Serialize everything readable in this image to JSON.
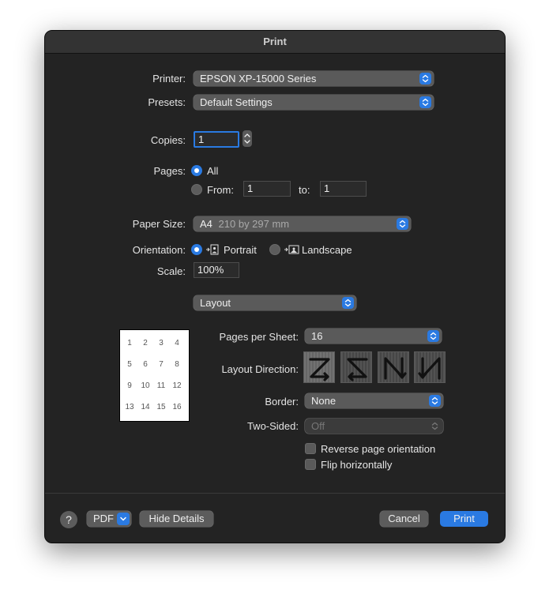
{
  "window": {
    "title": "Print"
  },
  "printer": {
    "label": "Printer:",
    "value": "EPSON XP-15000 Series"
  },
  "presets": {
    "label": "Presets:",
    "value": "Default Settings"
  },
  "copies": {
    "label": "Copies:",
    "value": "1"
  },
  "pages": {
    "label": "Pages:",
    "all_label": "All",
    "from_label": "From:",
    "from_value": "1",
    "to_label": "to:",
    "to_value": "1",
    "selected": "All"
  },
  "paper_size": {
    "label": "Paper Size:",
    "name": "A4",
    "dims": "210 by 297 mm"
  },
  "orientation": {
    "label": "Orientation:",
    "portrait_label": "Portrait",
    "landscape_label": "Landscape",
    "selected": "Portrait"
  },
  "scale": {
    "label": "Scale:",
    "value": "100%"
  },
  "section": {
    "value": "Layout"
  },
  "layout": {
    "pages_per_sheet_label": "Pages per Sheet:",
    "pages_per_sheet_value": "16",
    "direction_label": "Layout Direction:",
    "directions": [
      "z-right-down-icon",
      "z-left-down-icon",
      "n-down-right-icon",
      "n-down-left-icon"
    ],
    "border_label": "Border:",
    "border_value": "None",
    "two_sided_label": "Two-Sided:",
    "two_sided_value": "Off",
    "reverse_label": "Reverse page orientation",
    "flip_label": "Flip horizontally"
  },
  "preview": {
    "pages": [
      "1",
      "2",
      "3",
      "4",
      "5",
      "6",
      "7",
      "8",
      "9",
      "10",
      "11",
      "12",
      "13",
      "14",
      "15",
      "16"
    ]
  },
  "footer": {
    "help": "?",
    "pdf_label": "PDF",
    "hide_details": "Hide Details",
    "cancel": "Cancel",
    "print": "Print"
  },
  "colors": {
    "accent": "#2a7ae2",
    "window_bg": "#232323",
    "control_bg": "#5a5a5a"
  }
}
